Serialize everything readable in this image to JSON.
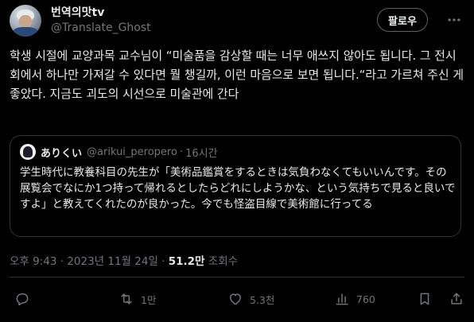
{
  "author": {
    "display_name": "번역의맛tv",
    "handle": "@Translate_Ghost",
    "avatar_icon": "person-avatar"
  },
  "follow_label": "팔로우",
  "more_icon": "more-horizontal-icon",
  "tweet": {
    "text": "학생 시절에 교양과목 교수님이 “미술품을 감상할 때는 너무 애쓰지 않아도 됩니다. 그 전시회에서 하나만 가져갈 수 있다면 뭘 챙길까, 이런 마음으로 보면 됩니다.“라고 가르쳐 주신 게 좋았다. 지금도 괴도의 시선으로 미술관에 간다"
  },
  "quote": {
    "display_name": "ありくい",
    "handle": "@arikui_peropero",
    "separator": "·",
    "time": "16시간",
    "text": "学生時代に教養科目の先生が「美術品鑑賞をするときは気負わなくてもいいんです。その展覧会でなにか1つ持って帰れるとしたらどれにしようかな、という気持ちで見ると良いですよ」と教えてくれたのが良かった。今でも怪盗目線で美術館に行ってる"
  },
  "meta": {
    "timestamp": "오후 9:43 · 2023년 11월 24일 · ",
    "views_count": "51.2만",
    "views_label": " 조회수"
  },
  "actions": {
    "reply": {
      "icon": "reply-icon",
      "count": ""
    },
    "retweet": {
      "icon": "retweet-icon",
      "count": "1만"
    },
    "like": {
      "icon": "heart-icon",
      "count": "5.3천"
    },
    "analytics": {
      "icon": "analytics-icon",
      "count": "760"
    },
    "bookmark": {
      "icon": "bookmark-icon",
      "count": ""
    },
    "share": {
      "icon": "share-icon",
      "count": ""
    }
  },
  "colors": {
    "background": "#000000",
    "text_primary": "#e7e9ea",
    "text_secondary": "#71767b",
    "border": "#2f3336"
  }
}
